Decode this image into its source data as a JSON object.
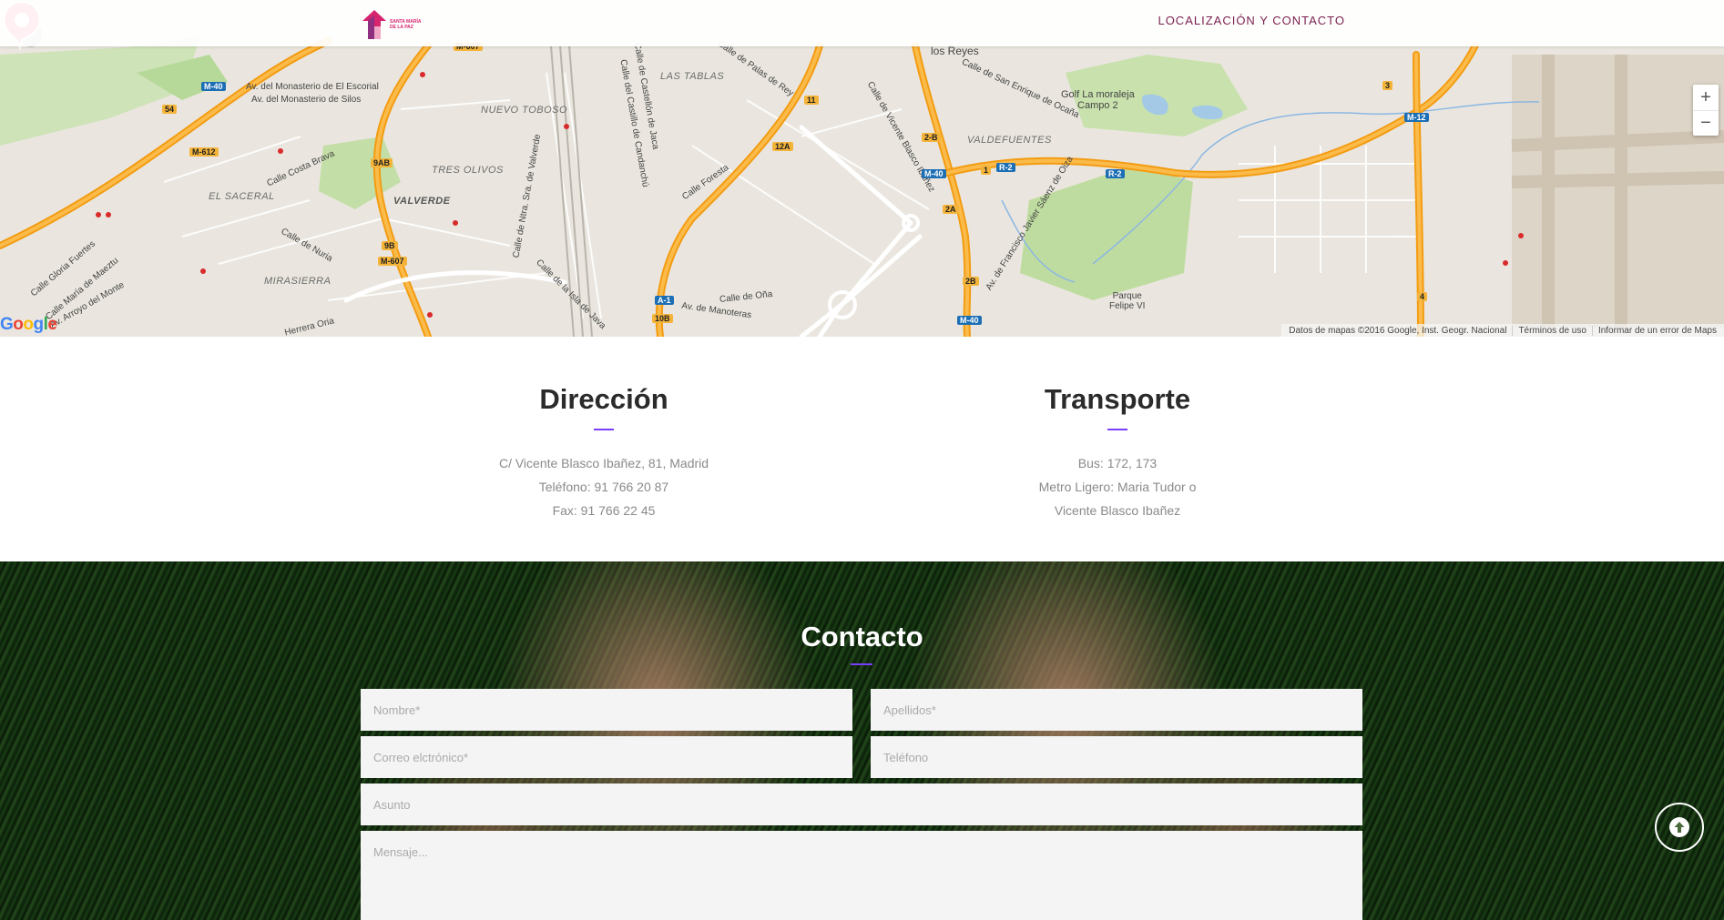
{
  "header": {
    "logo_text": "SANTA MARÍA\nDE LA PAZ",
    "nav_link": "LOCALIZACIÓN Y CONTACTO"
  },
  "map": {
    "labels": {
      "los_reyes": "los Reyes",
      "monasterio_escorial": "Av. del Monasterio de El Escorial",
      "monasterio_silos": "Av. del Monasterio de Silos",
      "nuevo_toboso": "NUEVO TOBOSO",
      "las_tablas": "LAS TABLAS",
      "tres_olivos": "TRES OLIVOS",
      "valverde": "VALVERDE",
      "el_saceral": "EL SACERAL",
      "mirasierra": "MIRASIERRA",
      "valdefuentes": "VALDEFUENTES",
      "golf": "Golf La moraleja\nCampo 2",
      "parque": "Parque\nFelipe VI",
      "costa_brava": "Calle Costa Brava",
      "nuria": "Calle de Nuria",
      "foresta": "Calle Foresta",
      "ona": "Calle de Oña",
      "manoteras": "Av. de Manoteras",
      "isla_java": "Calle de la Isla de Java",
      "palas_rey": "Calle de Palas de Rey",
      "san_enrique": "Calle de San Enrique de Ocaña",
      "vicente_blasco": "Calle de Vicente Blasco Ibáñez",
      "francisco_javier": "Av. de Francisco Javier Sáenz de Oiza",
      "castillo_candanchu": "Calle del Castillo de Candanchú",
      "castellon_jaca": "Calle de Castellón de Jaca",
      "gloria_fuertes": "Calle Gloria Fuertes",
      "maria_maeztu": "Calle María de Maeztu",
      "arroyo_monte": "Av. Arroyo del Monte",
      "herrera_oria": "Herrera Oria",
      "nira": "Calle de Ntra. Sra. de Valverde"
    },
    "shields": {
      "m40_a": "M-40",
      "m612": "M-612",
      "n54": "54",
      "n9ab": "9AB",
      "n9b": "9B",
      "m607": "M-607",
      "m607b": "M-607",
      "n11": "11",
      "n12a": "12A",
      "n2b": "2-B",
      "m40_b": "M-40",
      "r2": "R-2",
      "r2_b": "R-2",
      "n2a": "2A",
      "n2b2": "2B",
      "m40_c": "M-40",
      "a1": "A-1",
      "n10b": "10B",
      "m12": "M-12",
      "n3": "3",
      "n4": "4",
      "n1": "1"
    },
    "zoom_in": "+",
    "zoom_out": "−",
    "google": [
      "G",
      "o",
      "o",
      "g",
      "l",
      "e"
    ],
    "footer": {
      "data": "Datos de mapas ©2016 Google, Inst. Geogr. Nacional",
      "terms": "Términos de uso",
      "report": "Informar de un error de Maps"
    },
    "pin_color": "#ee2d5b"
  },
  "info": {
    "direccion": {
      "title": "Dirección",
      "lines": [
        "C/ Vicente Blasco Ibañez, 81, Madrid",
        "Teléfono: 91 766 20 87",
        "Fax: 91 766 22 45"
      ]
    },
    "transporte": {
      "title": "Transporte",
      "lines": [
        "Bus: 172, 173",
        "Metro Ligero: Maria Tudor o",
        "Vicente Blasco Ibañez"
      ]
    },
    "accent": "#7a3cff"
  },
  "contact": {
    "title": "Contacto",
    "fields": {
      "nombre": "Nombre*",
      "apellidos": "Apellidos*",
      "correo": "Correo elctrónico*",
      "telefono": "Teléfono",
      "asunto": "Asunto",
      "mensaje": "Mensaje..."
    }
  }
}
